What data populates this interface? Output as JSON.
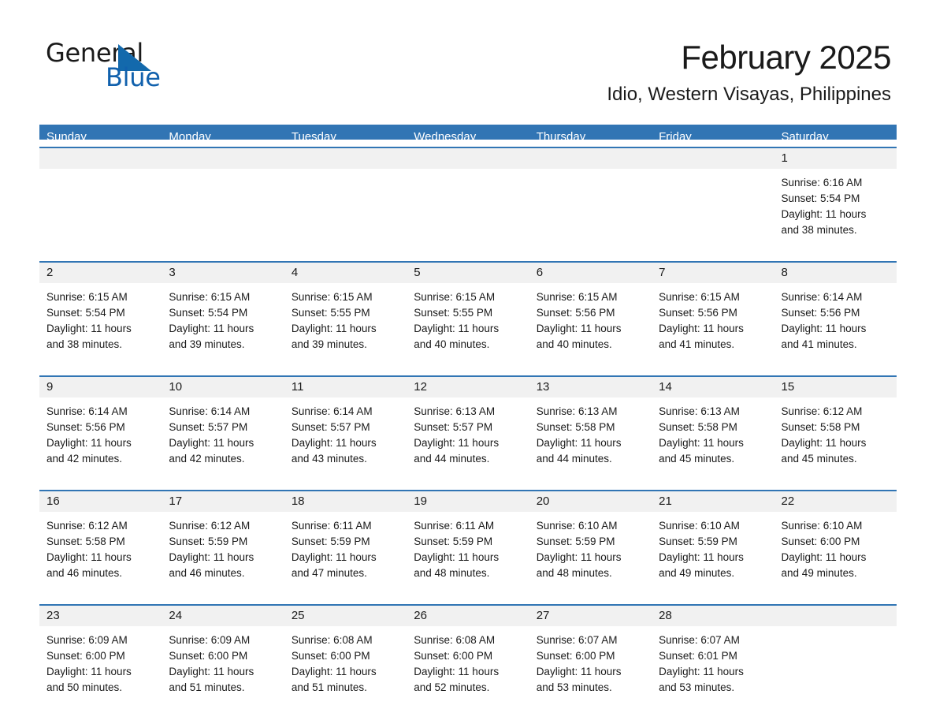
{
  "brand": {
    "name_part1": "General",
    "name_part2": "Blue",
    "triangle_color": "#1369ac",
    "text_color": "#1a1a1a",
    "blue_text_color": "#1161ad"
  },
  "header": {
    "title": "February 2025",
    "subtitle": "Idio, Western Visayas, Philippines"
  },
  "theme": {
    "header_bg": "#3175b4",
    "row_rule": "#3175b4",
    "daynum_bg": "#f1f1f1",
    "page_bg": "#ffffff"
  },
  "calendar": {
    "weekday_headers": [
      "Sunday",
      "Monday",
      "Tuesday",
      "Wednesday",
      "Thursday",
      "Friday",
      "Saturday"
    ],
    "weeks": [
      [
        {
          "day": "",
          "sunrise": "",
          "sunset": "",
          "daylight_l1": "",
          "daylight_l2": ""
        },
        {
          "day": "",
          "sunrise": "",
          "sunset": "",
          "daylight_l1": "",
          "daylight_l2": ""
        },
        {
          "day": "",
          "sunrise": "",
          "sunset": "",
          "daylight_l1": "",
          "daylight_l2": ""
        },
        {
          "day": "",
          "sunrise": "",
          "sunset": "",
          "daylight_l1": "",
          "daylight_l2": ""
        },
        {
          "day": "",
          "sunrise": "",
          "sunset": "",
          "daylight_l1": "",
          "daylight_l2": ""
        },
        {
          "day": "",
          "sunrise": "",
          "sunset": "",
          "daylight_l1": "",
          "daylight_l2": ""
        },
        {
          "day": "1",
          "sunrise": "Sunrise: 6:16 AM",
          "sunset": "Sunset: 5:54 PM",
          "daylight_l1": "Daylight: 11 hours",
          "daylight_l2": "and 38 minutes."
        }
      ],
      [
        {
          "day": "2",
          "sunrise": "Sunrise: 6:15 AM",
          "sunset": "Sunset: 5:54 PM",
          "daylight_l1": "Daylight: 11 hours",
          "daylight_l2": "and 38 minutes."
        },
        {
          "day": "3",
          "sunrise": "Sunrise: 6:15 AM",
          "sunset": "Sunset: 5:54 PM",
          "daylight_l1": "Daylight: 11 hours",
          "daylight_l2": "and 39 minutes."
        },
        {
          "day": "4",
          "sunrise": "Sunrise: 6:15 AM",
          "sunset": "Sunset: 5:55 PM",
          "daylight_l1": "Daylight: 11 hours",
          "daylight_l2": "and 39 minutes."
        },
        {
          "day": "5",
          "sunrise": "Sunrise: 6:15 AM",
          "sunset": "Sunset: 5:55 PM",
          "daylight_l1": "Daylight: 11 hours",
          "daylight_l2": "and 40 minutes."
        },
        {
          "day": "6",
          "sunrise": "Sunrise: 6:15 AM",
          "sunset": "Sunset: 5:56 PM",
          "daylight_l1": "Daylight: 11 hours",
          "daylight_l2": "and 40 minutes."
        },
        {
          "day": "7",
          "sunrise": "Sunrise: 6:15 AM",
          "sunset": "Sunset: 5:56 PM",
          "daylight_l1": "Daylight: 11 hours",
          "daylight_l2": "and 41 minutes."
        },
        {
          "day": "8",
          "sunrise": "Sunrise: 6:14 AM",
          "sunset": "Sunset: 5:56 PM",
          "daylight_l1": "Daylight: 11 hours",
          "daylight_l2": "and 41 minutes."
        }
      ],
      [
        {
          "day": "9",
          "sunrise": "Sunrise: 6:14 AM",
          "sunset": "Sunset: 5:56 PM",
          "daylight_l1": "Daylight: 11 hours",
          "daylight_l2": "and 42 minutes."
        },
        {
          "day": "10",
          "sunrise": "Sunrise: 6:14 AM",
          "sunset": "Sunset: 5:57 PM",
          "daylight_l1": "Daylight: 11 hours",
          "daylight_l2": "and 42 minutes."
        },
        {
          "day": "11",
          "sunrise": "Sunrise: 6:14 AM",
          "sunset": "Sunset: 5:57 PM",
          "daylight_l1": "Daylight: 11 hours",
          "daylight_l2": "and 43 minutes."
        },
        {
          "day": "12",
          "sunrise": "Sunrise: 6:13 AM",
          "sunset": "Sunset: 5:57 PM",
          "daylight_l1": "Daylight: 11 hours",
          "daylight_l2": "and 44 minutes."
        },
        {
          "day": "13",
          "sunrise": "Sunrise: 6:13 AM",
          "sunset": "Sunset: 5:58 PM",
          "daylight_l1": "Daylight: 11 hours",
          "daylight_l2": "and 44 minutes."
        },
        {
          "day": "14",
          "sunrise": "Sunrise: 6:13 AM",
          "sunset": "Sunset: 5:58 PM",
          "daylight_l1": "Daylight: 11 hours",
          "daylight_l2": "and 45 minutes."
        },
        {
          "day": "15",
          "sunrise": "Sunrise: 6:12 AM",
          "sunset": "Sunset: 5:58 PM",
          "daylight_l1": "Daylight: 11 hours",
          "daylight_l2": "and 45 minutes."
        }
      ],
      [
        {
          "day": "16",
          "sunrise": "Sunrise: 6:12 AM",
          "sunset": "Sunset: 5:58 PM",
          "daylight_l1": "Daylight: 11 hours",
          "daylight_l2": "and 46 minutes."
        },
        {
          "day": "17",
          "sunrise": "Sunrise: 6:12 AM",
          "sunset": "Sunset: 5:59 PM",
          "daylight_l1": "Daylight: 11 hours",
          "daylight_l2": "and 46 minutes."
        },
        {
          "day": "18",
          "sunrise": "Sunrise: 6:11 AM",
          "sunset": "Sunset: 5:59 PM",
          "daylight_l1": "Daylight: 11 hours",
          "daylight_l2": "and 47 minutes."
        },
        {
          "day": "19",
          "sunrise": "Sunrise: 6:11 AM",
          "sunset": "Sunset: 5:59 PM",
          "daylight_l1": "Daylight: 11 hours",
          "daylight_l2": "and 48 minutes."
        },
        {
          "day": "20",
          "sunrise": "Sunrise: 6:10 AM",
          "sunset": "Sunset: 5:59 PM",
          "daylight_l1": "Daylight: 11 hours",
          "daylight_l2": "and 48 minutes."
        },
        {
          "day": "21",
          "sunrise": "Sunrise: 6:10 AM",
          "sunset": "Sunset: 5:59 PM",
          "daylight_l1": "Daylight: 11 hours",
          "daylight_l2": "and 49 minutes."
        },
        {
          "day": "22",
          "sunrise": "Sunrise: 6:10 AM",
          "sunset": "Sunset: 6:00 PM",
          "daylight_l1": "Daylight: 11 hours",
          "daylight_l2": "and 49 minutes."
        }
      ],
      [
        {
          "day": "23",
          "sunrise": "Sunrise: 6:09 AM",
          "sunset": "Sunset: 6:00 PM",
          "daylight_l1": "Daylight: 11 hours",
          "daylight_l2": "and 50 minutes."
        },
        {
          "day": "24",
          "sunrise": "Sunrise: 6:09 AM",
          "sunset": "Sunset: 6:00 PM",
          "daylight_l1": "Daylight: 11 hours",
          "daylight_l2": "and 51 minutes."
        },
        {
          "day": "25",
          "sunrise": "Sunrise: 6:08 AM",
          "sunset": "Sunset: 6:00 PM",
          "daylight_l1": "Daylight: 11 hours",
          "daylight_l2": "and 51 minutes."
        },
        {
          "day": "26",
          "sunrise": "Sunrise: 6:08 AM",
          "sunset": "Sunset: 6:00 PM",
          "daylight_l1": "Daylight: 11 hours",
          "daylight_l2": "and 52 minutes."
        },
        {
          "day": "27",
          "sunrise": "Sunrise: 6:07 AM",
          "sunset": "Sunset: 6:00 PM",
          "daylight_l1": "Daylight: 11 hours",
          "daylight_l2": "and 53 minutes."
        },
        {
          "day": "28",
          "sunrise": "Sunrise: 6:07 AM",
          "sunset": "Sunset: 6:01 PM",
          "daylight_l1": "Daylight: 11 hours",
          "daylight_l2": "and 53 minutes."
        },
        {
          "day": "",
          "sunrise": "",
          "sunset": "",
          "daylight_l1": "",
          "daylight_l2": ""
        }
      ]
    ]
  }
}
